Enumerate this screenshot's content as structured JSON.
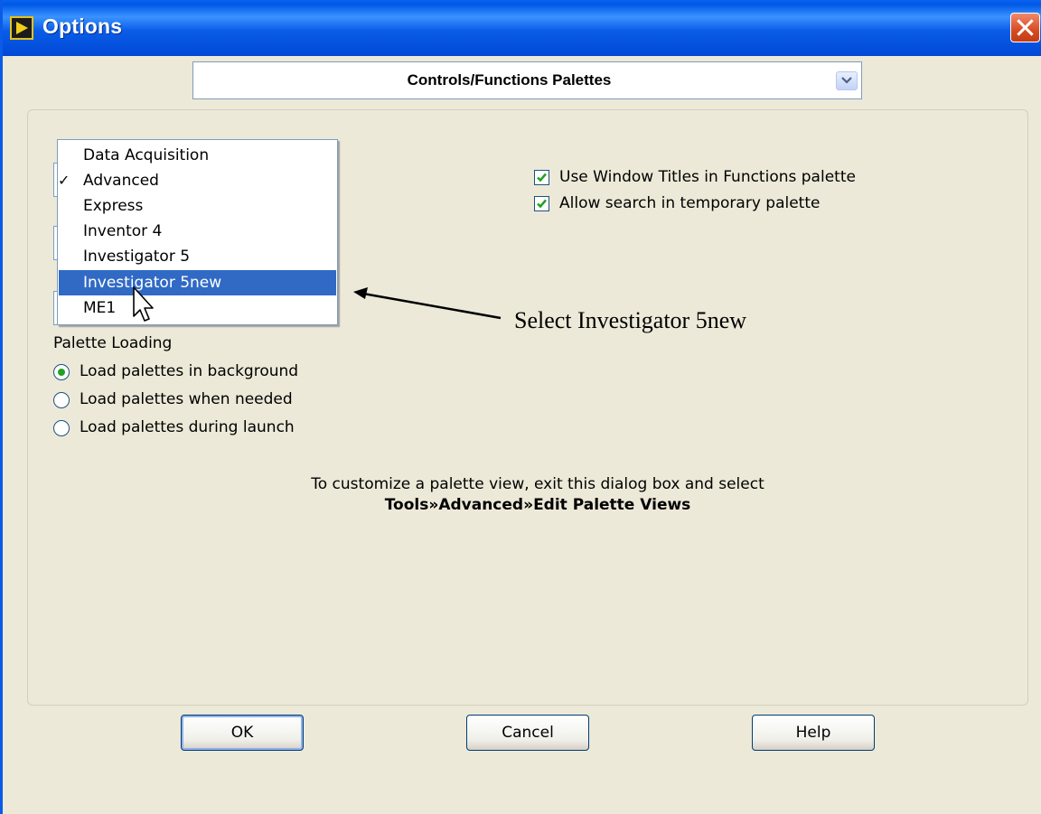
{
  "window": {
    "title": "Options"
  },
  "category": {
    "selected": "Controls/Functions Palettes"
  },
  "palette_view_menu": {
    "items": [
      {
        "label": "Data Acquisition",
        "checked": false,
        "highlighted": false
      },
      {
        "label": "Advanced",
        "checked": true,
        "highlighted": false
      },
      {
        "label": "Express",
        "checked": false,
        "highlighted": false
      },
      {
        "label": "Inventor 4",
        "checked": false,
        "highlighted": false
      },
      {
        "label": "Investigator 5",
        "checked": false,
        "highlighted": false
      },
      {
        "label": "Investigator 5new",
        "checked": false,
        "highlighted": true
      },
      {
        "label": "ME1",
        "checked": false,
        "highlighted": false
      }
    ],
    "check_glyph": "✓"
  },
  "options": {
    "use_window_titles": {
      "label": "Use Window Titles in Functions palette",
      "checked": true
    },
    "allow_search": {
      "label": "Allow search in temporary palette",
      "checked": true
    }
  },
  "palette_loading": {
    "title": "Palette Loading",
    "choices": [
      {
        "label": "Load palettes in background",
        "selected": true
      },
      {
        "label": "Load palettes when needed",
        "selected": false
      },
      {
        "label": "Load palettes during launch",
        "selected": false
      }
    ]
  },
  "hint": {
    "line1": "To customize a palette view, exit this dialog box and select",
    "line2": "Tools»Advanced»Edit Palette Views"
  },
  "annotation": {
    "text": "Select Investigator 5new"
  },
  "buttons": {
    "ok": "OK",
    "cancel": "Cancel",
    "help": "Help"
  },
  "colors": {
    "title_bar": "#0a5ce8",
    "selection": "#316ac5",
    "dialog_bg": "#ece9d8",
    "close": "#d84b22"
  }
}
